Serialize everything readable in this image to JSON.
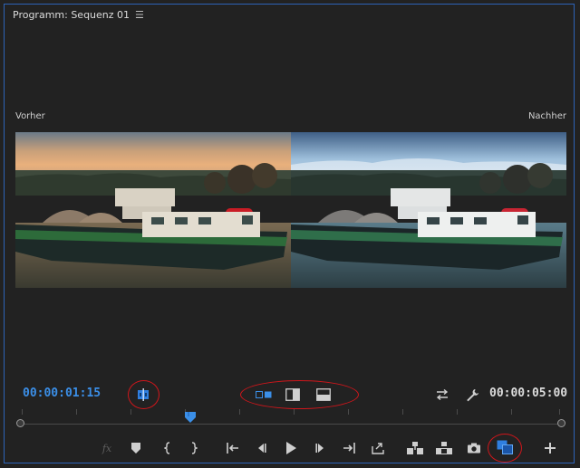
{
  "panel": {
    "title": "Programm: Sequenz 01",
    "menu_icon": "hamburger-menu-icon"
  },
  "labels": {
    "before": "Vorher",
    "after": "Nachher"
  },
  "timecodes": {
    "current": "00:00:01:15",
    "duration": "00:00:05:00"
  },
  "colors": {
    "accent": "#3b8fe8",
    "highlight": "#d0161b",
    "panel_border": "#2d63b8"
  },
  "controls": {
    "left": [
      "comparison-view-toggle-icon"
    ],
    "view_modes": [
      "side-by-side-icon",
      "vertical-split-icon",
      "horizontal-split-icon"
    ],
    "right_top": [
      "swap-sides-icon",
      "wrench-icon"
    ],
    "transport": [
      "fx-icon",
      "marker-icon",
      "mark-in-icon",
      "mark-out-icon",
      "go-to-in-icon",
      "step-back-icon",
      "play-icon",
      "step-forward-icon",
      "go-to-out-icon",
      "export-frame-lift-icon",
      "insert-icon",
      "overwrite-icon",
      "camera-icon",
      "comparison-view-icon",
      "add-button-icon"
    ]
  }
}
